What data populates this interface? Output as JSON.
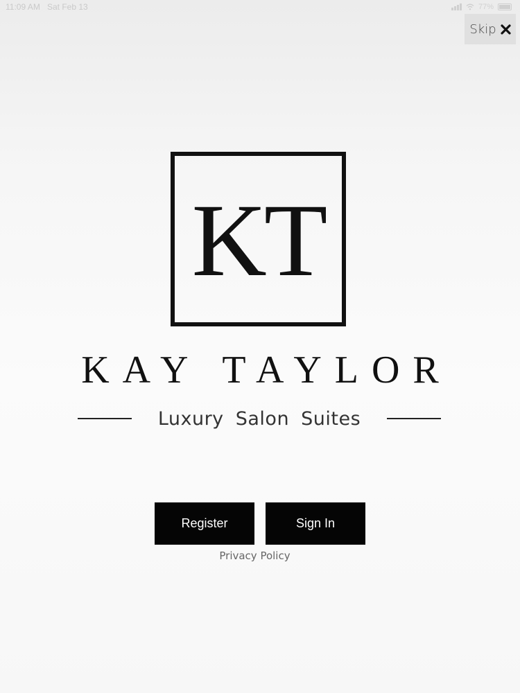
{
  "status_bar": {
    "time": "11:09 AM",
    "date": "Sat Feb 13",
    "battery_text": "77%"
  },
  "skip": {
    "label": "Skip",
    "icon": "close-icon"
  },
  "logo": {
    "monogram": "KT",
    "brand_name": "KAY TAYLOR",
    "tagline": "Luxury Salon Suites"
  },
  "actions": {
    "register_label": "Register",
    "sign_in_label": "Sign In"
  },
  "footer": {
    "privacy_label": "Privacy Policy"
  },
  "colors": {
    "button_bg": "#050505",
    "button_text": "#ffffff",
    "background": "#f7f7f7"
  }
}
